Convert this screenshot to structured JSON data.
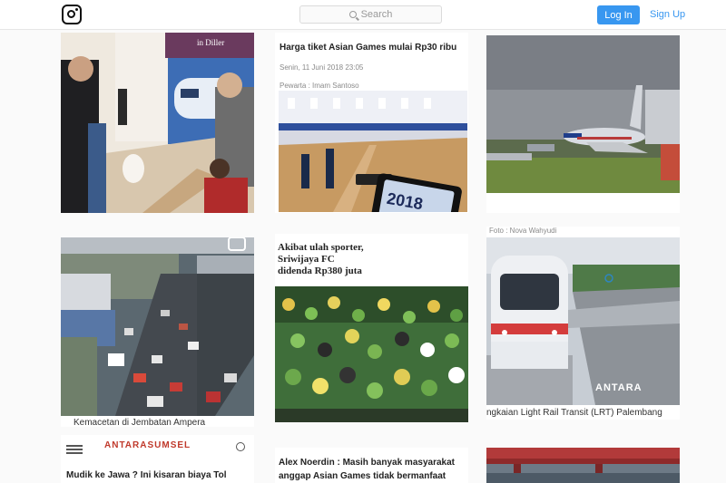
{
  "header": {
    "logo": "instagram-logo-icon",
    "search_placeholder": "Search",
    "login_label": "Log In",
    "signup_label": "Sign Up"
  },
  "posts": [
    {
      "id": 1,
      "image": "man-with-train-poster-photo",
      "banner_text": "in Diller"
    },
    {
      "id": 2,
      "title": "Harga tiket Asian Games mulai Rp30 ribu",
      "date": "Senin, 11 Juni 2018 23:05",
      "author": "Pewarta : Imam Santoso",
      "tablet_text": "2018"
    },
    {
      "id": 3,
      "image": "airplane-on-runway-photo"
    },
    {
      "id": 4,
      "image": "traffic-jam-aerial-photo",
      "caption": "Kemacetan di Jembatan Ampera"
    },
    {
      "id": 5,
      "title_lines": [
        "Akibat ulah sporter,",
        "Sriwijaya FC",
        "didenda Rp380 juta"
      ]
    },
    {
      "id": 6,
      "top_caption": "Foto : Nova Wahyudi",
      "bottom_caption": "ngkaian Light Rail Transit (LRT) Palembang",
      "watermark": "ANTARA"
    },
    {
      "id": 7,
      "logo_text": "ANTARASUMSEL",
      "title": "Mudik ke Jawa ? Ini kisaran biaya Tol"
    },
    {
      "id": 8,
      "title_lines": [
        "Alex Noerdin : Masih banyak masyarakat",
        "anggap Asian Games tidak bermanfaat"
      ]
    },
    {
      "id": 9,
      "image": "bridge-photo"
    }
  ]
}
